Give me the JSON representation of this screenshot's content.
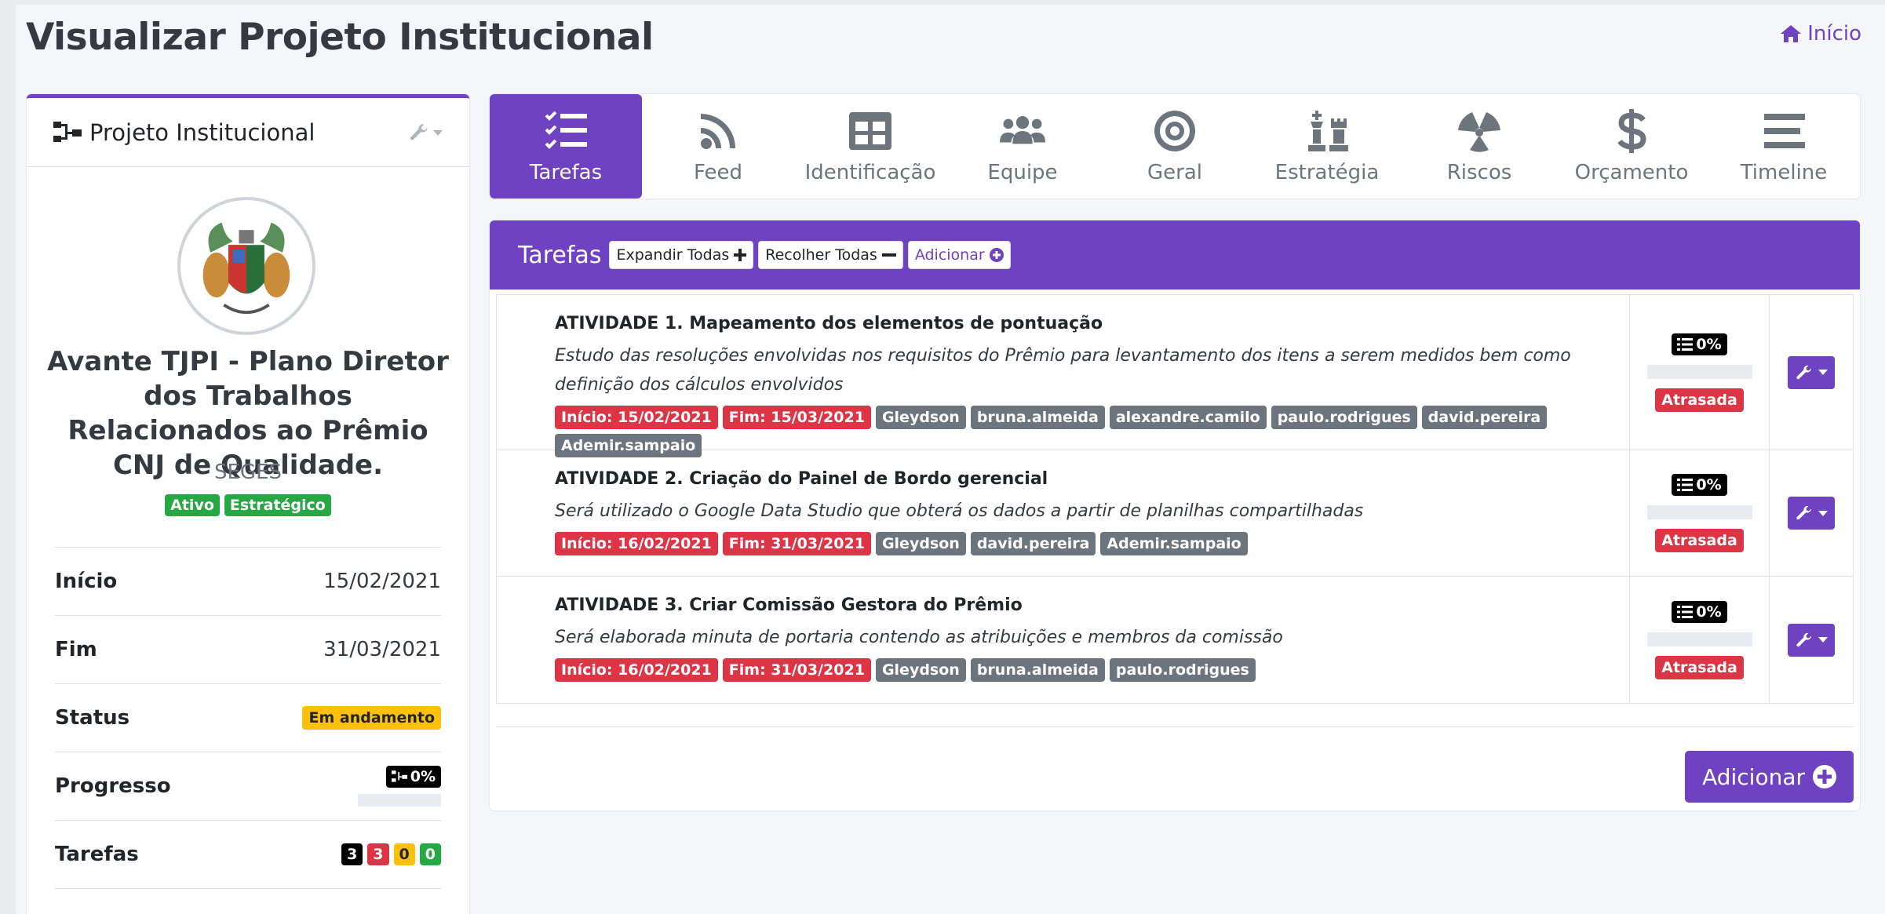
{
  "page": {
    "title": "Visualizar Projeto Institucional",
    "breadcrumb_home": "Início"
  },
  "card": {
    "title": "Projeto Institucional",
    "project_name": "Avante TJPI - Plano Diretor dos Trabalhos Relacionados ao Prêmio CNJ de Qualidade.",
    "department": "SEGES",
    "tags": [
      "Ativo",
      "Estratégico"
    ],
    "info": {
      "start_label": "Início",
      "start_value": "15/02/2021",
      "end_label": "Fim",
      "end_value": "31/03/2021",
      "status_label": "Status",
      "status_value": "Em andamento",
      "progress_label": "Progresso",
      "progress_value": "0%",
      "tasks_label": "Tarefas",
      "tasks_counts": [
        "3",
        "3",
        "0",
        "0"
      ]
    }
  },
  "tabs": [
    {
      "label": "Tarefas",
      "icon": "tasks-icon",
      "active": true
    },
    {
      "label": "Feed",
      "icon": "rss-icon"
    },
    {
      "label": "Identificação",
      "icon": "table-icon"
    },
    {
      "label": "Equipe",
      "icon": "users-icon"
    },
    {
      "label": "Geral",
      "icon": "bullseye-icon"
    },
    {
      "label": "Estratégia",
      "icon": "chess-icon"
    },
    {
      "label": "Riscos",
      "icon": "radiation-icon"
    },
    {
      "label": "Orçamento",
      "icon": "dollar-icon"
    },
    {
      "label": "Timeline",
      "icon": "bars-icon"
    }
  ],
  "tasks_panel": {
    "header": "Tarefas",
    "expand_all": "Expandir Todas",
    "collapse_all": "Recolher Todas",
    "add_small": "Adicionar",
    "add_big": "Adicionar",
    "items": [
      {
        "title": "ATIVIDADE 1. Mapeamento dos elementos de pontuação",
        "description": "Estudo das resoluções envolvidas nos requisitos do Prêmio para levantamento dos itens a serem medidos bem como definição dos cálculos envolvidos",
        "start": "Início: 15/02/2021",
        "end": "Fim: 15/03/2021",
        "people": [
          "Gleydson",
          "bruna.almeida",
          "alexandre.camilo",
          "paulo.rodrigues",
          "david.pereira",
          "Ademir.sampaio"
        ],
        "progress": "0%",
        "status": "Atrasada"
      },
      {
        "title": "ATIVIDADE 2. Criação do Painel de Bordo gerencial",
        "description": "Será utilizado o Google Data Studio que obterá os dados a partir de planilhas compartilhadas",
        "start": "Início: 16/02/2021",
        "end": "Fim: 31/03/2021",
        "people": [
          "Gleydson",
          "david.pereira",
          "Ademir.sampaio"
        ],
        "progress": "0%",
        "status": "Atrasada"
      },
      {
        "title": "ATIVIDADE 3. Criar Comissão Gestora do Prêmio",
        "description": "Será elaborada minuta de portaria contendo as atribuições e membros da comissão",
        "start": "Início: 16/02/2021",
        "end": "Fim: 31/03/2021",
        "people": [
          "Gleydson",
          "bruna.almeida",
          "paulo.rodrigues"
        ],
        "progress": "0%",
        "status": "Atrasada"
      }
    ]
  },
  "colors": {
    "primary": "#6f42c1",
    "danger": "#dc3545",
    "success": "#28a745",
    "warning": "#ffc107",
    "secondary": "#6c757d"
  }
}
